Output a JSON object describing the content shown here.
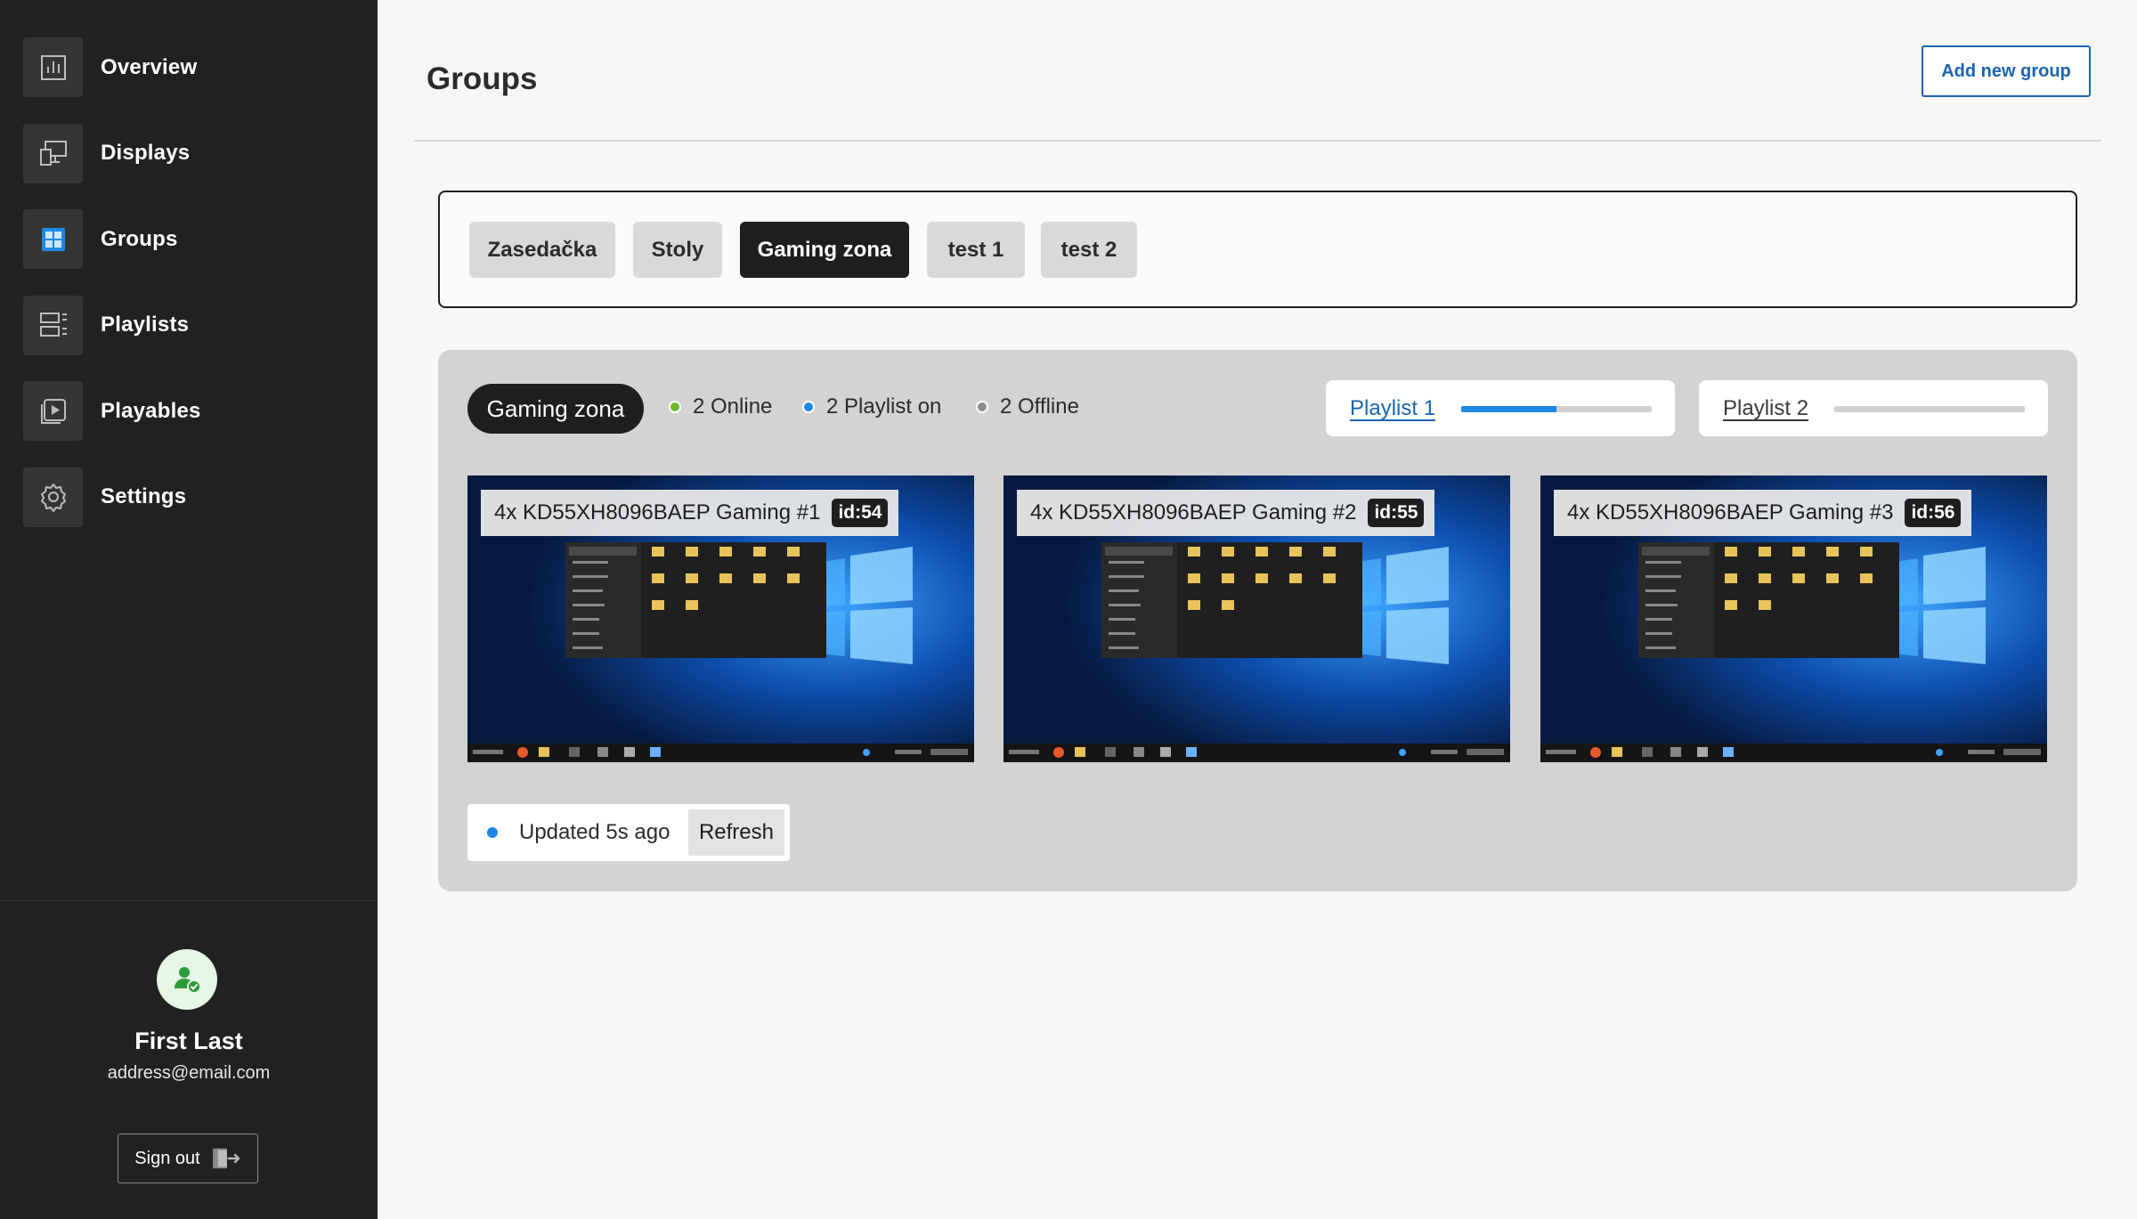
{
  "sidebar": {
    "items": [
      {
        "label": "Overview",
        "icon": "chart-bar-icon"
      },
      {
        "label": "Displays",
        "icon": "display-icon"
      },
      {
        "label": "Groups",
        "icon": "grid-icon",
        "active": true
      },
      {
        "label": "Playlists",
        "icon": "list-icon"
      },
      {
        "label": "Playables",
        "icon": "play-icon"
      },
      {
        "label": "Settings",
        "icon": "gear-icon"
      }
    ],
    "user": {
      "name": "First Last",
      "email": "address@email.com"
    },
    "sign_out_label": "Sign out"
  },
  "header": {
    "title": "Groups",
    "add_button": "Add new group"
  },
  "tabs": [
    "Zasedačka",
    "Stoly",
    "Gaming zona",
    "test 1",
    "test 2"
  ],
  "active_tab": "Gaming zona",
  "group": {
    "name": "Gaming zona",
    "status": {
      "online": "2 Online",
      "playlist_on": "2 Playlist on",
      "offline": "2 Offline"
    },
    "playlists": [
      {
        "label": "Playlist 1",
        "progress": 0.5,
        "active": true
      },
      {
        "label": "Playlist 2",
        "progress": 0,
        "active": false
      }
    ],
    "displays": [
      {
        "name": "4x KD55XH8096BAEP Gaming #1",
        "id": "id:54"
      },
      {
        "name": "4x KD55XH8096BAEP Gaming #2",
        "id": "id:55"
      },
      {
        "name": "4x KD55XH8096BAEP Gaming #3",
        "id": "id:56"
      }
    ],
    "updated_text": "Updated 5s ago",
    "refresh_label": "Refresh"
  },
  "colors": {
    "accent": "#1a64b0",
    "online": "#6fb52c",
    "playlist": "#1e88e5",
    "offline": "#8c8c8c",
    "sidebar": "#212121"
  }
}
